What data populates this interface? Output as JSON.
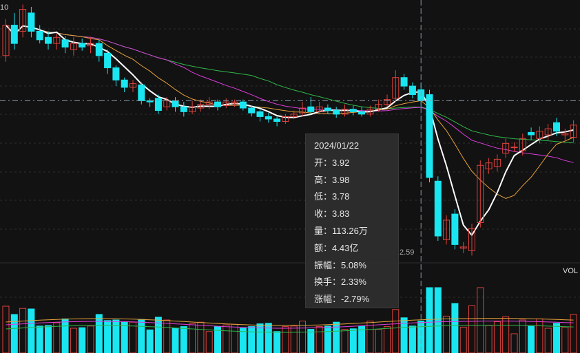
{
  "colors": {
    "background": "#121212",
    "up": "#e0413c",
    "down": "#19e6f0",
    "ma5": "#ffffff",
    "ma10": "#e8a13c",
    "ma20": "#e03ce0",
    "ma30": "#2fb84a",
    "grid": "#3a3a3a",
    "crosshair": "#8a9aaa"
  },
  "axis": {
    "max_label": "10",
    "min_label": "2.59"
  },
  "volume": {
    "label": "VOL"
  },
  "tooltip": {
    "date": "2024/01/22",
    "rows": [
      {
        "label": "开：",
        "value": "3.92"
      },
      {
        "label": "高：",
        "value": "3.98"
      },
      {
        "label": "低：",
        "value": "3.78"
      },
      {
        "label": "收：",
        "value": "3.83"
      },
      {
        "label": "量：",
        "value": "113.26万"
      },
      {
        "label": "额：",
        "value": "4.43亿"
      },
      {
        "label": "振幅：",
        "value": "5.08%"
      },
      {
        "label": "换手：",
        "value": "2.33%"
      },
      {
        "label": "涨幅：",
        "value": "-2.79%"
      }
    ]
  },
  "chart_data": {
    "type": "candlestick",
    "price_range": [
      2.59,
      4.6
    ],
    "crosshair_price": 3.83,
    "candles": [
      [
        4.2,
        4.45,
        4.5,
        4.15
      ],
      [
        4.45,
        4.3,
        4.55,
        4.25
      ],
      [
        4.4,
        4.58,
        4.62,
        4.35
      ],
      [
        4.55,
        4.4,
        4.6,
        4.35
      ],
      [
        4.4,
        4.33,
        4.45,
        4.3
      ],
      [
        4.35,
        4.3,
        4.4,
        4.25
      ],
      [
        4.3,
        4.35,
        4.38,
        4.25
      ],
      [
        4.33,
        4.27,
        4.36,
        4.22
      ],
      [
        4.25,
        4.3,
        4.35,
        4.2
      ],
      [
        4.3,
        4.27,
        4.34,
        4.24
      ],
      [
        4.28,
        4.3,
        4.35,
        4.22
      ],
      [
        4.3,
        4.2,
        4.33,
        4.15
      ],
      [
        4.22,
        4.1,
        4.25,
        4.05
      ],
      [
        4.1,
        4.0,
        4.12,
        3.95
      ],
      [
        4.0,
        3.94,
        4.02,
        3.9
      ],
      [
        3.94,
        3.97,
        4.0,
        3.9
      ],
      [
        3.96,
        3.83,
        3.98,
        3.8
      ],
      [
        3.83,
        3.82,
        3.85,
        3.78
      ],
      [
        3.85,
        3.75,
        3.88,
        3.72
      ],
      [
        3.78,
        3.83,
        3.86,
        3.75
      ],
      [
        3.83,
        3.78,
        3.86,
        3.74
      ],
      [
        3.78,
        3.74,
        3.82,
        3.7
      ],
      [
        3.74,
        3.78,
        3.83,
        3.72
      ],
      [
        3.77,
        3.8,
        3.84,
        3.74
      ],
      [
        3.8,
        3.82,
        3.86,
        3.76
      ],
      [
        3.82,
        3.78,
        3.84,
        3.75
      ],
      [
        3.79,
        3.82,
        3.85,
        3.77
      ],
      [
        3.81,
        3.82,
        3.84,
        3.78
      ],
      [
        3.82,
        3.77,
        3.84,
        3.75
      ],
      [
        3.77,
        3.73,
        3.79,
        3.7
      ],
      [
        3.74,
        3.7,
        3.76,
        3.66
      ],
      [
        3.7,
        3.68,
        3.73,
        3.65
      ],
      [
        3.68,
        3.66,
        3.7,
        3.62
      ],
      [
        3.66,
        3.7,
        3.72,
        3.64
      ],
      [
        3.7,
        3.72,
        3.75,
        3.68
      ],
      [
        3.73,
        3.77,
        3.82,
        3.7
      ],
      [
        3.78,
        3.74,
        3.86,
        3.72
      ],
      [
        3.74,
        3.78,
        3.82,
        3.72
      ],
      [
        3.77,
        3.75,
        3.8,
        3.72
      ],
      [
        3.75,
        3.72,
        3.78,
        3.69
      ],
      [
        3.72,
        3.76,
        3.8,
        3.7
      ],
      [
        3.76,
        3.74,
        3.79,
        3.71
      ],
      [
        3.74,
        3.72,
        3.78,
        3.7
      ],
      [
        3.72,
        3.76,
        3.79,
        3.7
      ],
      [
        3.76,
        3.8,
        3.84,
        3.74
      ],
      [
        3.8,
        3.84,
        3.88,
        3.78
      ],
      [
        3.85,
        4.02,
        4.08,
        3.82
      ],
      [
        4.02,
        3.95,
        4.05,
        3.92
      ],
      [
        3.95,
        3.88,
        3.98,
        3.85
      ],
      [
        3.92,
        3.83,
        3.98,
        3.78
      ]
    ],
    "volumes": []
  }
}
